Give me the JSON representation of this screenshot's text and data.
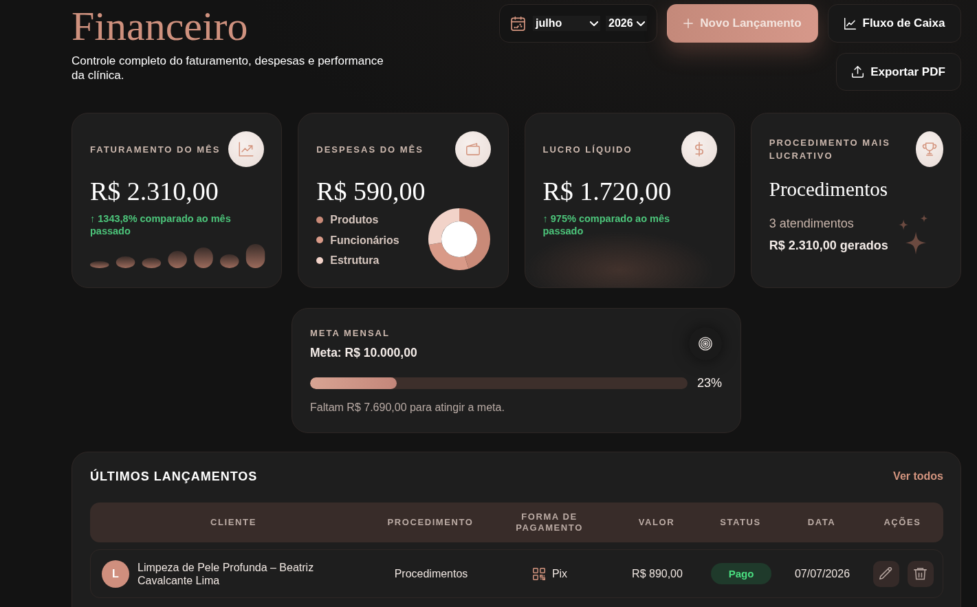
{
  "header": {
    "title": "Financeiro",
    "subtitle": "Controle completo do faturamento, despesas e performance da clínica.",
    "period": {
      "month": "julho",
      "year": "2026"
    },
    "actions": [
      {
        "kind": "primary",
        "label": "Novo Lançamento"
      },
      {
        "kind": "chart",
        "label": "Fluxo de Caixa"
      },
      {
        "kind": "export",
        "label": "Exportar PDF"
      }
    ]
  },
  "cards": [
    {
      "kind": "revenue",
      "label": "FATURAMENTO DO MÊS",
      "value": "R$ 2.310,00",
      "trend": "↑ 1343,8% comparado ao mês passado"
    },
    {
      "kind": "expenses",
      "label": "DESPESAS DO MÊS",
      "value": "R$ 590,00",
      "legend": [
        {
          "label": "Produtos",
          "color": "#c98a78"
        },
        {
          "label": "Funcionários",
          "color": "#d99a88"
        },
        {
          "label": "Estrutura",
          "color": "#f2d3c9"
        }
      ]
    },
    {
      "kind": "profit",
      "label": "LUCRO LÍQUIDO",
      "value": "R$ 1.720,00",
      "trend": "↑ 975% comparado ao mês passado"
    },
    {
      "kind": "top",
      "label": "PROCEDIMENTO MAIS LUCRATIVO",
      "title": "Procedimentos",
      "count": "3 atendimentos",
      "amount": "R$ 2.310,00 gerados"
    }
  ],
  "goal": {
    "label": "META MENSAL",
    "target": "Meta: R$ 10.000,00",
    "level": 0.23,
    "percent": "23%",
    "remaining": "Faltam R$ 7.690,00 para atingir a meta."
  },
  "recent": {
    "title": "ÚLTIMOS LANÇAMENTOS",
    "link": "Ver todos",
    "columns": [
      "CLIENTE",
      "PROCEDIMENTO",
      "FORMA DE PAGAMENTO",
      "VALOR",
      "STATUS",
      "DATA",
      "AÇÕES"
    ],
    "rows": [
      {
        "initial": "L",
        "client": "Limpeza de Pele Profunda – Beatriz Cavalcante Lima",
        "procedure": "Procedimentos",
        "payment": "Pix",
        "value": "R$ 890,00",
        "status": "Pago",
        "date": "07/07/2026"
      }
    ]
  }
}
